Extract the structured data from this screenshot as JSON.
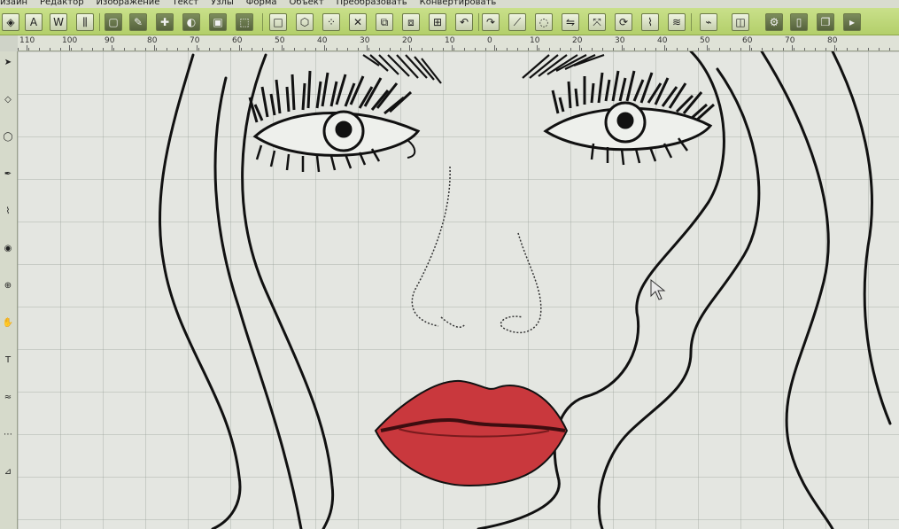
{
  "menu": {
    "items": [
      {
        "label": "изайн"
      },
      {
        "label": "Редактор"
      },
      {
        "label": "Изображение"
      },
      {
        "label": "Текст"
      },
      {
        "label": "Узлы"
      },
      {
        "label": "Форма"
      },
      {
        "label": "Объект"
      },
      {
        "label": "Преобразовать"
      },
      {
        "label": "Конвертировать"
      }
    ]
  },
  "toolbar": {
    "icons": [
      "layers-icon",
      "text-a-icon",
      "text-w-icon",
      "align-icon",
      "new-document-icon",
      "edit-pen-icon",
      "add-node-icon",
      "bucket-icon",
      "save-icon",
      "select-box-icon",
      "dotted-rect-icon",
      "shape-select-icon",
      "scatter-icon",
      "delete-x-icon",
      "group-icon",
      "ungroup-icon",
      "combine-icon",
      "undo-icon",
      "redo-icon",
      "knife-icon",
      "lasso-icon",
      "flip-icon",
      "transform-icon",
      "rotate-icon",
      "eyedropper-icon",
      "stitch-icon",
      "connect-icon",
      "view-icon",
      "settings-icon",
      "page-icon",
      "copy-icon",
      "more-icon"
    ]
  },
  "ruler": {
    "labels": [
      "110",
      "100",
      "90",
      "80",
      "70",
      "60",
      "50",
      "40",
      "30",
      "20",
      "10",
      "0",
      "10",
      "20",
      "30",
      "40",
      "50",
      "60",
      "70",
      "80"
    ]
  },
  "vruler": {
    "icons": [
      "pointer-icon",
      "node-icon",
      "shape-icon",
      "pen-icon",
      "brush-icon",
      "fill-icon",
      "zoom-icon",
      "hand-icon",
      "text-icon",
      "satin-icon",
      "stitch-run-icon",
      "measure-icon"
    ]
  },
  "colors": {
    "toolbar": "#b3cf6a",
    "canvas": "#e4e6e1",
    "lips": "#c9383d",
    "outline": "#111111"
  }
}
